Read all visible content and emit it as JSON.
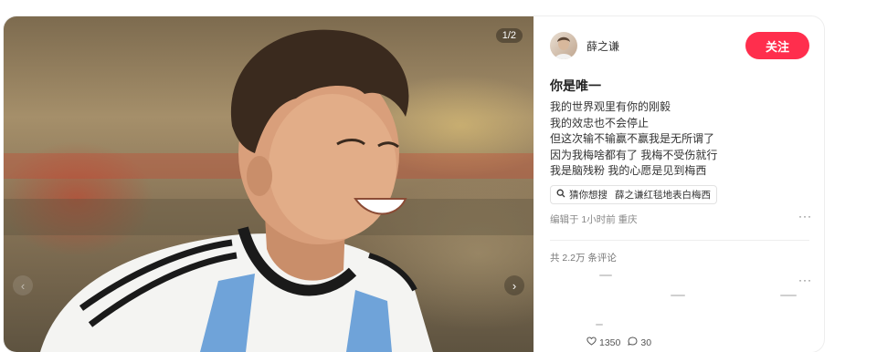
{
  "post": {
    "image_counter": "1/2",
    "nav_prev_icon": "chevron-left-icon",
    "nav_next_icon": "chevron-right-icon"
  },
  "author": {
    "name": "薛之谦",
    "follow_label": "关注"
  },
  "note": {
    "title": "你是唯一",
    "lines": [
      "我的世界观里有你的刚毅",
      "我的效忠也不会停止",
      "但这次输不输赢不赢我是无所谓了",
      "因为我梅啥都有了 我梅不受伤就行",
      "我是脑残粉 我的心愿是见到梅西"
    ],
    "search_tag_prefix": "猜你想搜",
    "search_tag_query": "薛之谦红毯地表白梅西",
    "meta": "编辑于 1小时前 重庆"
  },
  "comments": {
    "count_label": "共 2.2万 条评论",
    "likes": "1350",
    "replies": "30"
  },
  "colors": {
    "accent": "#ff2e4d"
  }
}
